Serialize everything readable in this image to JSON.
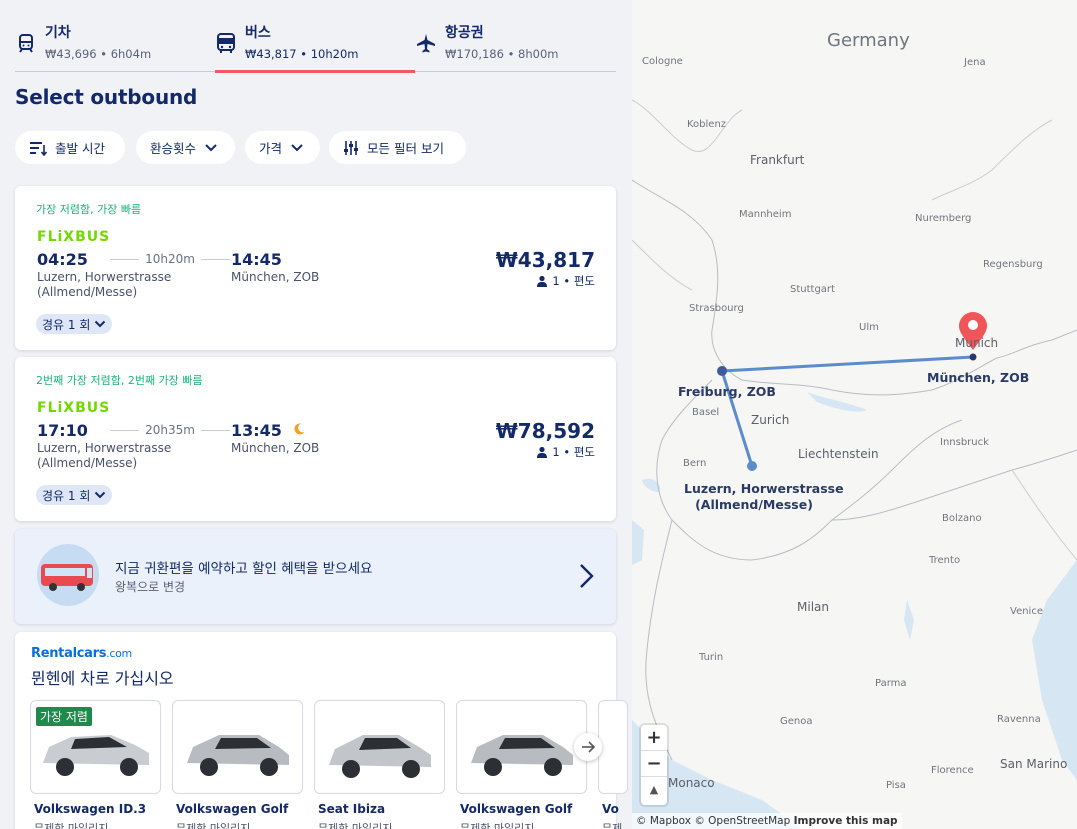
{
  "tabs": [
    {
      "label": "기차",
      "sub": "₩43,696 • 6h04m",
      "icon": "train-icon"
    },
    {
      "label": "버스",
      "sub": "₩43,817 • 10h20m",
      "icon": "bus-icon"
    },
    {
      "label": "항공권",
      "sub": "₩170,186 • 8h00m",
      "icon": "plane-icon"
    }
  ],
  "heading": "Select outbound",
  "filters": {
    "departure": "출발 시간",
    "transfers": "환승횟수",
    "price": "가격",
    "all": "모든 필터 보기"
  },
  "results": [
    {
      "badge": "가장 저렴함, 가장 빠름",
      "operator": "FLiXBUS",
      "dep_time": "04:25",
      "duration": "10h20m",
      "arr_time": "14:45",
      "dep_stop": "Luzern, Horwerstrasse (Allmend/Messe)",
      "arr_stop": "München, ZOB",
      "price": "₩43,817",
      "pax": "1 • 편도",
      "via": "경유 1 회"
    },
    {
      "badge": "2번째 가장 저렴함, 2번째 가장 빠름",
      "operator": "FLiXBUS",
      "dep_time": "17:10",
      "duration": "20h35m",
      "arr_time": "13:45",
      "dep_stop": "Luzern, Horwerstrasse (Allmend/Messe)",
      "arr_stop": "München, ZOB",
      "price": "₩78,592",
      "pax": "1 • 편도",
      "via": "경유 1 회"
    }
  ],
  "promo": {
    "title": "지금 귀환편을 예약하고 할인 혜택을 받으세요",
    "sub": "왕복으로 변경"
  },
  "rentalcars": {
    "logo": "Rentalcars",
    "logo_suffix": ".com",
    "title": "뮌헨에 차로 가십시오",
    "cheapest_badge": "가장 저렴",
    "cars": [
      {
        "name": "Volkswagen ID.3",
        "sub": "무제한 마일리지"
      },
      {
        "name": "Volkswagen Golf",
        "sub": "무제한 마일리지"
      },
      {
        "name": "Seat Ibiza",
        "sub": "무제한 마일리지"
      },
      {
        "name": "Volkswagen Golf",
        "sub": "무제한 마일리지"
      },
      {
        "name": "Vo",
        "sub": "무제"
      }
    ]
  },
  "map": {
    "country": "Germany",
    "cities": [
      "Cologne",
      "Jena",
      "Koblenz",
      "Frankfurt",
      "Mannheim",
      "Nuremberg",
      "Regensburg",
      "Stuttgart",
      "Strasbourg",
      "Ulm",
      "Munich",
      "Basel",
      "Zurich",
      "Bern",
      "Liechtenstein",
      "Innsbruck",
      "Bolzano",
      "Trento",
      "Milan",
      "Turin",
      "Parma",
      "Genoa",
      "Monaco",
      "Venice",
      "Ravenna",
      "Florence",
      "San Marino",
      "Pisa"
    ],
    "stops": {
      "freiburg": "Freiburg, ZOB",
      "munich": "München, ZOB",
      "luzern_1": "Luzern, Horwerstrasse",
      "luzern_2": "(Allmend/Messe)"
    },
    "zoom_in": "+",
    "zoom_out": "−",
    "compass": "▲",
    "attribution": {
      "mapbox": "© Mapbox",
      "osm": "© OpenStreetMap",
      "improve": "Improve this map"
    },
    "route_color": "#5b8ccb",
    "pin_color": "#f0555a"
  }
}
